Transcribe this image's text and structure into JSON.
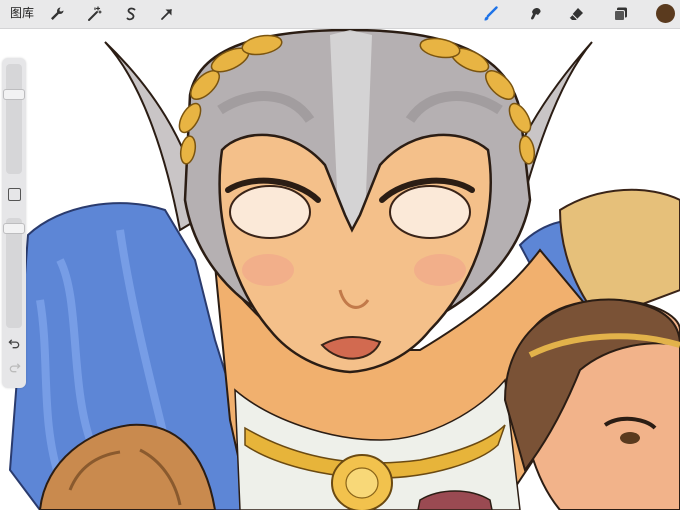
{
  "toolbar": {
    "gallery_label": "图库",
    "left_icons": [
      "wrench-icon",
      "magic-wand-icon",
      "selection-s-icon",
      "move-arrow-icon"
    ],
    "right_icons": [
      "brush-icon",
      "smudge-icon",
      "eraser-icon",
      "layers-icon"
    ],
    "active_tool": "brush",
    "accent_color": "#1e73e8",
    "current_color": "#5a3a1e"
  },
  "sidebar": {
    "brush_size_level": 0.25,
    "opacity_level": 0.05,
    "icons": [
      "modify-square-icon",
      "undo-icon",
      "redo-icon"
    ]
  }
}
